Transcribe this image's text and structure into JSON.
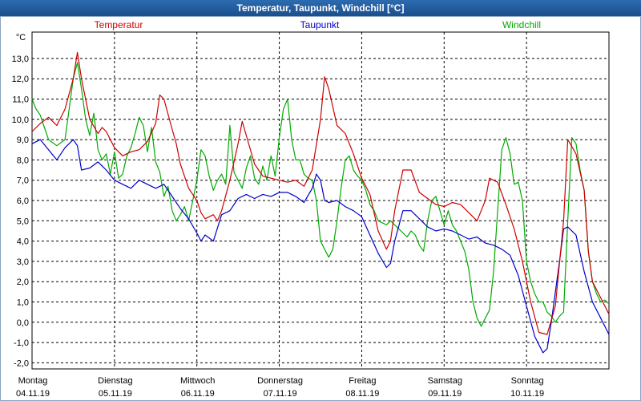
{
  "window": {
    "title": "Temperatur, Taupunkt, Windchill [°C]"
  },
  "chart_data": {
    "type": "line",
    "title": "Temperatur, Taupunkt, Windchill [°C]",
    "ylabel": "°C",
    "ylim": [
      -2.3,
      14.3
    ],
    "y_ticks": [
      "13,0",
      "12,0",
      "11,0",
      "10,0",
      "9,0",
      "8,0",
      "7,0",
      "6,0",
      "5,0",
      "4,0",
      "3,0",
      "2,0",
      "1,0",
      "0,0",
      "-1,0",
      "-2,0"
    ],
    "y_tick_values": [
      13,
      12,
      11,
      10,
      9,
      8,
      7,
      6,
      5,
      4,
      3,
      2,
      1,
      0,
      -1,
      -2
    ],
    "x_range": [
      0,
      7
    ],
    "x_ticks": [
      {
        "day": "Montag",
        "date": "04.11.19"
      },
      {
        "day": "Dienstag",
        "date": "05.11.19"
      },
      {
        "day": "Mittwoch",
        "date": "06.11.19"
      },
      {
        "day": "Donnerstag",
        "date": "07.11.19"
      },
      {
        "day": "Freitag",
        "date": "08.11.19"
      },
      {
        "day": "Samstag",
        "date": "09.11.19"
      },
      {
        "day": "Sonntag",
        "date": "10.11.19"
      }
    ],
    "grid": true,
    "legend": "top",
    "series": [
      {
        "name": "Temperatur",
        "color": "#cc0000",
        "points": [
          [
            0,
            9.4
          ],
          [
            0.1,
            9.8
          ],
          [
            0.2,
            10.1
          ],
          [
            0.3,
            9.7
          ],
          [
            0.4,
            10.5
          ],
          [
            0.5,
            12.0
          ],
          [
            0.55,
            13.3
          ],
          [
            0.6,
            12.0
          ],
          [
            0.7,
            10.0
          ],
          [
            0.8,
            9.3
          ],
          [
            0.85,
            9.6
          ],
          [
            0.9,
            9.4
          ],
          [
            1.0,
            8.6
          ],
          [
            1.1,
            8.2
          ],
          [
            1.2,
            8.4
          ],
          [
            1.3,
            8.5
          ],
          [
            1.4,
            8.9
          ],
          [
            1.5,
            9.8
          ],
          [
            1.55,
            11.2
          ],
          [
            1.6,
            11.0
          ],
          [
            1.7,
            9.5
          ],
          [
            1.75,
            8.8
          ],
          [
            1.8,
            7.8
          ],
          [
            1.9,
            6.6
          ],
          [
            2.0,
            6.0
          ],
          [
            2.05,
            5.4
          ],
          [
            2.1,
            5.1
          ],
          [
            2.2,
            5.3
          ],
          [
            2.25,
            5.0
          ],
          [
            2.3,
            5.5
          ],
          [
            2.4,
            7.0
          ],
          [
            2.5,
            8.8
          ],
          [
            2.55,
            9.9
          ],
          [
            2.6,
            9.2
          ],
          [
            2.7,
            7.8
          ],
          [
            2.8,
            7.2
          ],
          [
            2.9,
            7.1
          ],
          [
            3.0,
            7.0
          ],
          [
            3.1,
            6.9
          ],
          [
            3.2,
            7.0
          ],
          [
            3.3,
            6.7
          ],
          [
            3.4,
            7.5
          ],
          [
            3.5,
            10.0
          ],
          [
            3.55,
            12.1
          ],
          [
            3.6,
            11.5
          ],
          [
            3.7,
            9.7
          ],
          [
            3.8,
            9.3
          ],
          [
            3.9,
            8.3
          ],
          [
            4.0,
            7.1
          ],
          [
            4.1,
            6.3
          ],
          [
            4.2,
            4.5
          ],
          [
            4.3,
            3.6
          ],
          [
            4.35,
            4.0
          ],
          [
            4.4,
            5.5
          ],
          [
            4.5,
            7.5
          ],
          [
            4.6,
            7.5
          ],
          [
            4.7,
            6.4
          ],
          [
            4.8,
            6.1
          ],
          [
            4.9,
            5.8
          ],
          [
            5.0,
            5.7
          ],
          [
            5.1,
            5.9
          ],
          [
            5.2,
            5.8
          ],
          [
            5.3,
            5.4
          ],
          [
            5.4,
            5.0
          ],
          [
            5.5,
            6.0
          ],
          [
            5.55,
            7.1
          ],
          [
            5.65,
            6.9
          ],
          [
            5.75,
            5.8
          ],
          [
            5.85,
            4.6
          ],
          [
            5.95,
            3.0
          ],
          [
            6.05,
            1.0
          ],
          [
            6.15,
            -0.5
          ],
          [
            6.25,
            -0.6
          ],
          [
            6.35,
            0.8
          ],
          [
            6.45,
            5.0
          ],
          [
            6.5,
            9.0
          ],
          [
            6.6,
            8.3
          ],
          [
            6.7,
            6.5
          ],
          [
            6.75,
            3.5
          ],
          [
            6.8,
            2.0
          ],
          [
            6.9,
            1.2
          ],
          [
            7.0,
            0.4
          ]
        ]
      },
      {
        "name": "Taupunkt",
        "color": "#0000cc",
        "points": [
          [
            0,
            8.8
          ],
          [
            0.1,
            9.0
          ],
          [
            0.2,
            8.5
          ],
          [
            0.3,
            8.0
          ],
          [
            0.4,
            8.6
          ],
          [
            0.5,
            9.0
          ],
          [
            0.55,
            8.7
          ],
          [
            0.6,
            7.5
          ],
          [
            0.7,
            7.6
          ],
          [
            0.8,
            7.9
          ],
          [
            0.9,
            7.5
          ],
          [
            1.0,
            7.0
          ],
          [
            1.1,
            6.8
          ],
          [
            1.2,
            6.6
          ],
          [
            1.3,
            7.0
          ],
          [
            1.4,
            6.8
          ],
          [
            1.5,
            6.6
          ],
          [
            1.6,
            6.8
          ],
          [
            1.7,
            6.2
          ],
          [
            1.8,
            5.6
          ],
          [
            1.9,
            5.1
          ],
          [
            2.0,
            4.4
          ],
          [
            2.05,
            4.0
          ],
          [
            2.1,
            4.3
          ],
          [
            2.2,
            4.0
          ],
          [
            2.3,
            5.3
          ],
          [
            2.4,
            5.5
          ],
          [
            2.5,
            6.1
          ],
          [
            2.6,
            6.3
          ],
          [
            2.7,
            6.1
          ],
          [
            2.8,
            6.3
          ],
          [
            2.9,
            6.2
          ],
          [
            3.0,
            6.4
          ],
          [
            3.1,
            6.4
          ],
          [
            3.2,
            6.2
          ],
          [
            3.3,
            5.9
          ],
          [
            3.4,
            6.6
          ],
          [
            3.45,
            7.3
          ],
          [
            3.5,
            7.0
          ],
          [
            3.55,
            6.0
          ],
          [
            3.6,
            5.9
          ],
          [
            3.7,
            6.0
          ],
          [
            3.8,
            5.7
          ],
          [
            3.9,
            5.5
          ],
          [
            4.0,
            5.2
          ],
          [
            4.1,
            4.3
          ],
          [
            4.2,
            3.4
          ],
          [
            4.3,
            2.7
          ],
          [
            4.35,
            2.9
          ],
          [
            4.4,
            4.0
          ],
          [
            4.5,
            5.5
          ],
          [
            4.6,
            5.5
          ],
          [
            4.7,
            5.1
          ],
          [
            4.8,
            4.7
          ],
          [
            4.9,
            4.5
          ],
          [
            5.0,
            4.6
          ],
          [
            5.1,
            4.5
          ],
          [
            5.2,
            4.3
          ],
          [
            5.3,
            4.1
          ],
          [
            5.4,
            4.2
          ],
          [
            5.5,
            3.9
          ],
          [
            5.6,
            3.8
          ],
          [
            5.7,
            3.6
          ],
          [
            5.8,
            3.3
          ],
          [
            5.9,
            2.3
          ],
          [
            6.0,
            0.8
          ],
          [
            6.1,
            -0.7
          ],
          [
            6.2,
            -1.5
          ],
          [
            6.25,
            -1.3
          ],
          [
            6.3,
            0.0
          ],
          [
            6.4,
            3.0
          ],
          [
            6.45,
            4.6
          ],
          [
            6.5,
            4.7
          ],
          [
            6.6,
            4.3
          ],
          [
            6.7,
            2.5
          ],
          [
            6.8,
            1.0
          ],
          [
            6.9,
            0.2
          ],
          [
            7.0,
            -0.6
          ]
        ]
      },
      {
        "name": "Windchill",
        "color": "#00aa00",
        "points": [
          [
            0,
            11.0
          ],
          [
            0.05,
            10.5
          ],
          [
            0.1,
            10.2
          ],
          [
            0.15,
            9.6
          ],
          [
            0.2,
            9.0
          ],
          [
            0.3,
            8.7
          ],
          [
            0.4,
            9.0
          ],
          [
            0.45,
            10.5
          ],
          [
            0.5,
            12.0
          ],
          [
            0.55,
            12.8
          ],
          [
            0.6,
            11.5
          ],
          [
            0.65,
            10.0
          ],
          [
            0.7,
            9.2
          ],
          [
            0.75,
            10.3
          ],
          [
            0.8,
            8.5
          ],
          [
            0.85,
            8.0
          ],
          [
            0.9,
            8.3
          ],
          [
            0.95,
            7.3
          ],
          [
            1.0,
            8.4
          ],
          [
            1.05,
            7.1
          ],
          [
            1.1,
            7.3
          ],
          [
            1.15,
            8.2
          ],
          [
            1.2,
            8.6
          ],
          [
            1.25,
            9.3
          ],
          [
            1.3,
            10.1
          ],
          [
            1.35,
            9.7
          ],
          [
            1.4,
            8.4
          ],
          [
            1.45,
            9.6
          ],
          [
            1.5,
            7.9
          ],
          [
            1.55,
            7.4
          ],
          [
            1.6,
            6.2
          ],
          [
            1.65,
            6.7
          ],
          [
            1.7,
            5.5
          ],
          [
            1.75,
            5.0
          ],
          [
            1.8,
            5.3
          ],
          [
            1.85,
            5.7
          ],
          [
            1.9,
            5.0
          ],
          [
            1.95,
            6.0
          ],
          [
            2.0,
            7.0
          ],
          [
            2.05,
            8.5
          ],
          [
            2.1,
            8.2
          ],
          [
            2.15,
            7.2
          ],
          [
            2.2,
            6.5
          ],
          [
            2.25,
            7.0
          ],
          [
            2.3,
            7.3
          ],
          [
            2.35,
            6.8
          ],
          [
            2.4,
            9.7
          ],
          [
            2.45,
            7.4
          ],
          [
            2.5,
            7.0
          ],
          [
            2.55,
            6.6
          ],
          [
            2.6,
            7.6
          ],
          [
            2.65,
            8.2
          ],
          [
            2.7,
            7.1
          ],
          [
            2.75,
            6.8
          ],
          [
            2.8,
            7.7
          ],
          [
            2.85,
            7.0
          ],
          [
            2.9,
            8.2
          ],
          [
            2.95,
            7.2
          ],
          [
            3.0,
            9.1
          ],
          [
            3.05,
            10.5
          ],
          [
            3.1,
            11.0
          ],
          [
            3.15,
            9.0
          ],
          [
            3.2,
            8.0
          ],
          [
            3.25,
            8.0
          ],
          [
            3.3,
            7.3
          ],
          [
            3.35,
            7.1
          ],
          [
            3.4,
            7.0
          ],
          [
            3.45,
            6.0
          ],
          [
            3.5,
            4.0
          ],
          [
            3.55,
            3.6
          ],
          [
            3.6,
            3.2
          ],
          [
            3.65,
            3.6
          ],
          [
            3.7,
            5.0
          ],
          [
            3.75,
            6.6
          ],
          [
            3.8,
            8.0
          ],
          [
            3.85,
            8.2
          ],
          [
            3.9,
            7.5
          ],
          [
            3.95,
            7.2
          ],
          [
            4.0,
            7.0
          ],
          [
            4.05,
            6.5
          ],
          [
            4.1,
            5.8
          ],
          [
            4.15,
            5.5
          ],
          [
            4.2,
            5.0
          ],
          [
            4.25,
            4.9
          ],
          [
            4.3,
            4.8
          ],
          [
            4.35,
            5.0
          ],
          [
            4.4,
            4.8
          ],
          [
            4.45,
            4.6
          ],
          [
            4.5,
            4.4
          ],
          [
            4.55,
            4.2
          ],
          [
            4.6,
            4.5
          ],
          [
            4.65,
            4.3
          ],
          [
            4.7,
            3.8
          ],
          [
            4.75,
            3.5
          ],
          [
            4.8,
            5.0
          ],
          [
            4.85,
            6.0
          ],
          [
            4.9,
            6.2
          ],
          [
            4.95,
            5.5
          ],
          [
            5.0,
            4.8
          ],
          [
            5.05,
            5.5
          ],
          [
            5.1,
            4.8
          ],
          [
            5.15,
            4.5
          ],
          [
            5.2,
            4.0
          ],
          [
            5.25,
            3.5
          ],
          [
            5.3,
            2.6
          ],
          [
            5.35,
            1.0
          ],
          [
            5.4,
            0.2
          ],
          [
            5.45,
            -0.2
          ],
          [
            5.5,
            0.2
          ],
          [
            5.55,
            0.6
          ],
          [
            5.6,
            2.5
          ],
          [
            5.65,
            5.5
          ],
          [
            5.7,
            8.5
          ],
          [
            5.75,
            9.1
          ],
          [
            5.8,
            8.3
          ],
          [
            5.85,
            6.8
          ],
          [
            5.9,
            6.9
          ],
          [
            5.95,
            6.0
          ],
          [
            6.0,
            3.0
          ],
          [
            6.05,
            2.0
          ],
          [
            6.1,
            1.4
          ],
          [
            6.15,
            1.0
          ],
          [
            6.2,
            1.0
          ],
          [
            6.25,
            0.5
          ],
          [
            6.3,
            0.3
          ],
          [
            6.35,
            0.0
          ],
          [
            6.4,
            0.3
          ],
          [
            6.45,
            0.5
          ],
          [
            6.5,
            5.0
          ],
          [
            6.55,
            9.1
          ],
          [
            6.6,
            8.8
          ],
          [
            6.65,
            7.5
          ],
          [
            6.7,
            6.5
          ],
          [
            6.75,
            3.5
          ],
          [
            6.8,
            2.0
          ],
          [
            6.85,
            1.4
          ],
          [
            6.9,
            1.0
          ],
          [
            6.95,
            1.1
          ],
          [
            7.0,
            0.9
          ]
        ]
      }
    ]
  }
}
